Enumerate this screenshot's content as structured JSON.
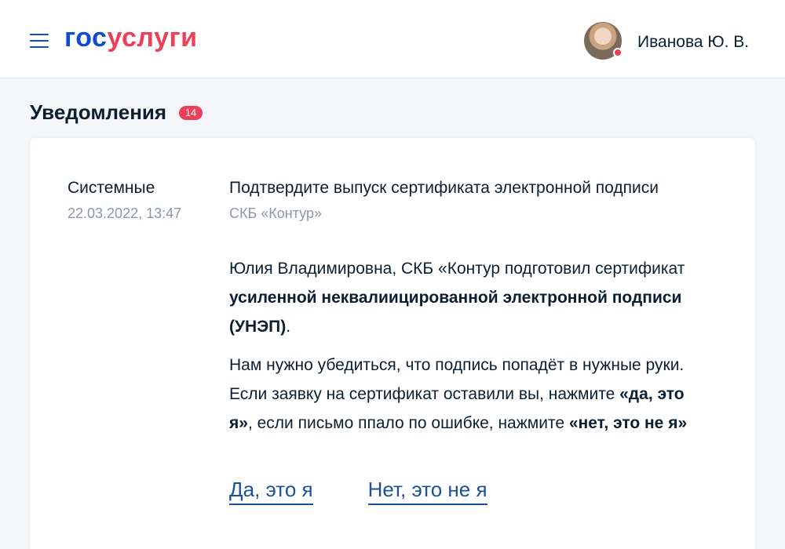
{
  "header": {
    "logo": {
      "part1": "гос",
      "part2": "услуги"
    },
    "user_name": "Иванова Ю. В."
  },
  "page": {
    "title": "Уведомления",
    "badge_count": "14"
  },
  "notification": {
    "category": "Системные",
    "date": "22.03.2022, 13:47",
    "title": "Подтвердите выпуск сертификата электронной подписи",
    "sender": "СКБ «Контур»",
    "paragraph1": {
      "text_a": "Юлия Владимировна, СКБ «Контур подготовил сертификат ",
      "text_bold": "усиленной неквалиицированной электронной подписи (УНЭП)",
      "text_b": "."
    },
    "paragraph2": {
      "text_a": "Нам нужно убедиться, что подпись попадёт в нужные руки. Если заявку на сертификат оставили вы, нажмите ",
      "bold1": "«да, это я»",
      "text_b": ", если письмо ппало по ошибке, нажмите ",
      "bold2": "«нет, это не я»"
    },
    "actions": {
      "yes": "Да, это я",
      "no": "Нет, это не я"
    }
  },
  "colors": {
    "brand_blue": "#0d4cd3",
    "brand_red": "#ee3f58",
    "link": "#1c4f9c",
    "muted": "#8a99ab"
  },
  "icons": {
    "menu": "hamburger-menu-icon",
    "status": "status-dot-icon"
  }
}
